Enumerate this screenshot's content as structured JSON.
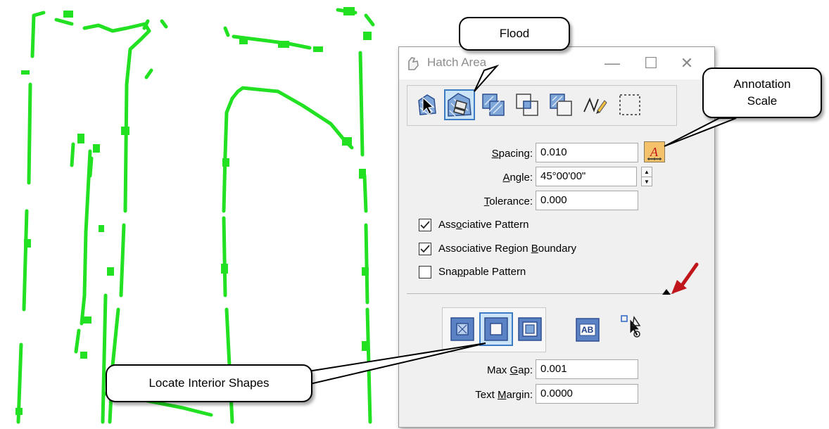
{
  "dialog": {
    "title": "Hatch Area",
    "minimize_glyph": "—",
    "maximize_glyph": "☐",
    "close_glyph": "✕"
  },
  "tools": [
    {
      "icon": "hatch-element-icon",
      "selected": false
    },
    {
      "icon": "flood-icon",
      "selected": true
    },
    {
      "icon": "union-icon",
      "selected": false
    },
    {
      "icon": "intersection-icon",
      "selected": false
    },
    {
      "icon": "difference-icon",
      "selected": false
    },
    {
      "icon": "points-icon",
      "selected": false
    },
    {
      "icon": "fence-icon",
      "selected": false
    }
  ],
  "form": {
    "spacing_label_pre": "",
    "spacing_label_u": "S",
    "spacing_label_post": "pacing:",
    "spacing_value": "0.010",
    "angle_label_u": "A",
    "angle_label_post": "ngle:",
    "angle_value": "45°00'00\"",
    "tolerance_label_u": "T",
    "tolerance_label_post": "olerance:",
    "tolerance_value": "0.000",
    "assoc_pattern_pre": "Ass",
    "assoc_pattern_u": "o",
    "assoc_pattern_post": "ciative Pattern",
    "assoc_pattern_checked": true,
    "assoc_region_pre": "Associative Region ",
    "assoc_region_u": "B",
    "assoc_region_post": "oundary",
    "assoc_region_checked": true,
    "snappable_pre": "Sna",
    "snappable_u": "p",
    "snappable_post": "pable Pattern",
    "snappable_checked": false,
    "max_gap_label_pre": "Max ",
    "max_gap_label_u": "G",
    "max_gap_label_post": "ap:",
    "max_gap_value": "0.001",
    "text_margin_label_pre": "Text ",
    "text_margin_label_u": "M",
    "text_margin_label_post": "argin:",
    "text_margin_value": "0.0000"
  },
  "modes": [
    {
      "icon": "ignore-interior-icon",
      "selected": false
    },
    {
      "icon": "locate-interior-shapes-icon",
      "selected": true
    },
    {
      "icon": "alternating-icon",
      "selected": false
    }
  ],
  "extras": {
    "text_icon_label": "AB",
    "text_icon": "text-boundary-icon",
    "select_icon": "select-element-icon"
  },
  "callouts": {
    "flood": "Flood",
    "annotation_line1": "Annotation",
    "annotation_line2": "Scale",
    "interior": "Locate Interior Shapes"
  },
  "colors": {
    "drawing_lines": "#22e022",
    "selection_blue": "#3d7cc4",
    "arrow_red": "#c0161b",
    "hatch_blue": "#3e63a8"
  }
}
